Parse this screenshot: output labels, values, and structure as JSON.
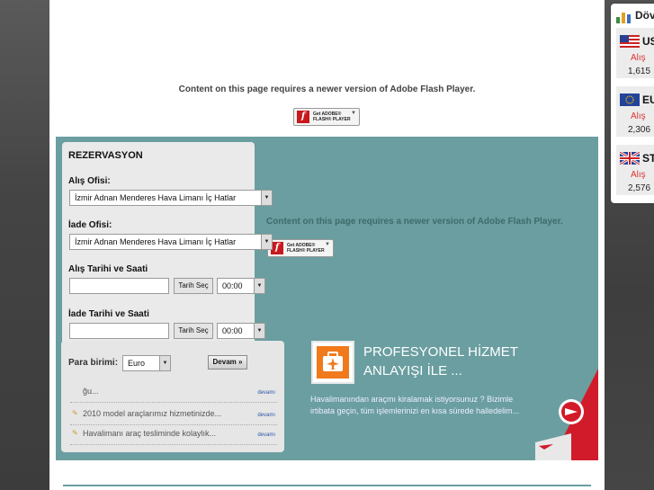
{
  "flash": {
    "notice": "Content on this page requires a newer version of Adobe Flash Player.",
    "badge_logo": "f",
    "badge_line1": "Get ADOBE®",
    "badge_line2": "FLASH® PLAYER",
    "badge_icon": "download-arrow-icon"
  },
  "reservation": {
    "title": "REZERVASYON",
    "pickup_office_label": "Alış Ofisi:",
    "pickup_office_value": "İzmir Adnan Menderes Hava Limanı İç Hatlar",
    "return_office_label": "İade Ofisi:",
    "return_office_value": "İzmir Adnan Menderes Hava Limanı İç Hatlar",
    "pickup_datetime_label": "Alış Tarihi ve Saati",
    "return_datetime_label": "İade Tarihi ve Saati",
    "date_button": "Tarih Seç",
    "pickup_time": "00:00",
    "return_time": "00:00"
  },
  "currency_form": {
    "label": "Para birimi:",
    "value": "Euro",
    "continue_button": "Devam »"
  },
  "news": {
    "items": [
      {
        "text": "ğu...",
        "more": "devamı"
      },
      {
        "text": "2010 model araçlarımız hizmetinizde...",
        "more": "devamı"
      },
      {
        "text": "Havalimanı araç tesliminde kolaylık...",
        "more": "devamı"
      }
    ]
  },
  "promo": {
    "headline": "PROFESYONEL HİZMET ANLAYIŞI İLE ...",
    "body": "Havalimanından araçmı kiralamak istiyorsunuz ? Bizimle irtibata geçin, tüm işlemlerinizi en kısa sürede halledelim...",
    "icon": "suitcase-plane-icon"
  },
  "currency_widget": {
    "title": "Döv",
    "rates": [
      {
        "code": "US",
        "flag": "us-flag-icon",
        "alis_label": "Alış",
        "alis_value": "1,615"
      },
      {
        "code": "EU",
        "flag": "eu-flag-icon",
        "alis_label": "Alış",
        "alis_value": "2,306"
      },
      {
        "code": "ST",
        "flag": "uk-flag-icon",
        "alis_label": "Alış",
        "alis_value": "2,576"
      }
    ]
  },
  "colors": {
    "teal": "#6a9ea0",
    "orange": "#f07a1c",
    "flash_red": "#c8181e",
    "rate_red": "#dd3333"
  }
}
